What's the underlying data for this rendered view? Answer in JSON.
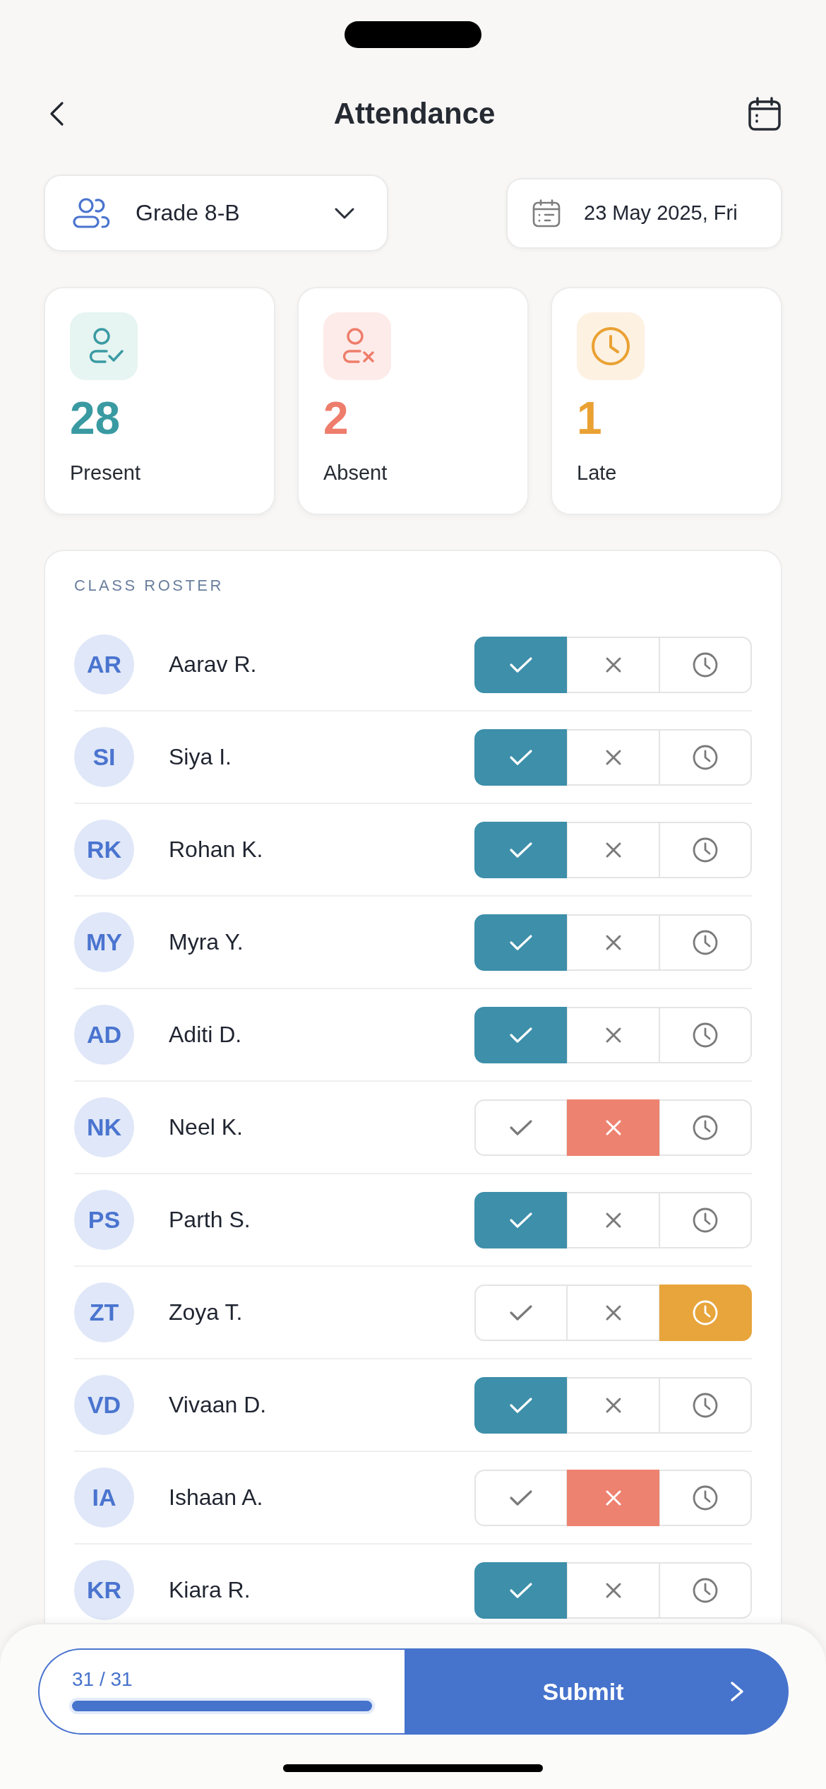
{
  "header": {
    "title": "Attendance"
  },
  "class_picker": {
    "value": "Grade 8-B"
  },
  "date_picker": {
    "value": "23 May 2025, Fri"
  },
  "stats": [
    {
      "kind": "present",
      "count": "28",
      "label": "Present"
    },
    {
      "kind": "absent",
      "count": "2",
      "label": "Absent"
    },
    {
      "kind": "late",
      "count": "1",
      "label": "Late"
    }
  ],
  "roster": {
    "heading": "CLASS ROSTER",
    "students": [
      {
        "initials": "AR",
        "name": "Aarav R.",
        "marks": [
          {
            "kind": "present",
            "selected": true
          },
          {
            "kind": "absent",
            "selected": false
          },
          {
            "kind": "late",
            "selected": false
          }
        ]
      },
      {
        "initials": "SI",
        "name": "Siya I.",
        "marks": [
          {
            "kind": "present",
            "selected": true
          },
          {
            "kind": "absent",
            "selected": false
          },
          {
            "kind": "late",
            "selected": false
          }
        ]
      },
      {
        "initials": "RK",
        "name": "Rohan K.",
        "marks": [
          {
            "kind": "present",
            "selected": true
          },
          {
            "kind": "absent",
            "selected": false
          },
          {
            "kind": "late",
            "selected": false
          }
        ]
      },
      {
        "initials": "MY",
        "name": "Myra Y.",
        "marks": [
          {
            "kind": "present",
            "selected": true
          },
          {
            "kind": "absent",
            "selected": false
          },
          {
            "kind": "late",
            "selected": false
          }
        ]
      },
      {
        "initials": "AD",
        "name": "Aditi D.",
        "marks": [
          {
            "kind": "present",
            "selected": true
          },
          {
            "kind": "absent",
            "selected": false
          },
          {
            "kind": "late",
            "selected": false
          }
        ]
      },
      {
        "initials": "NK",
        "name": "Neel K.",
        "marks": [
          {
            "kind": "present",
            "selected": false
          },
          {
            "kind": "absent",
            "selected": true
          },
          {
            "kind": "late",
            "selected": false
          }
        ]
      },
      {
        "initials": "PS",
        "name": "Parth S.",
        "marks": [
          {
            "kind": "present",
            "selected": true
          },
          {
            "kind": "absent",
            "selected": false
          },
          {
            "kind": "late",
            "selected": false
          }
        ]
      },
      {
        "initials": "ZT",
        "name": "Zoya T.",
        "marks": [
          {
            "kind": "present",
            "selected": false
          },
          {
            "kind": "absent",
            "selected": false
          },
          {
            "kind": "late",
            "selected": true
          }
        ]
      },
      {
        "initials": "VD",
        "name": "Vivaan D.",
        "marks": [
          {
            "kind": "present",
            "selected": true
          },
          {
            "kind": "absent",
            "selected": false
          },
          {
            "kind": "late",
            "selected": false
          }
        ]
      },
      {
        "initials": "IA",
        "name": "Ishaan A.",
        "marks": [
          {
            "kind": "present",
            "selected": false
          },
          {
            "kind": "absent",
            "selected": true
          },
          {
            "kind": "late",
            "selected": false
          }
        ]
      },
      {
        "initials": "KR",
        "name": "Kiara R.",
        "marks": [
          {
            "kind": "present",
            "selected": true
          },
          {
            "kind": "absent",
            "selected": false
          },
          {
            "kind": "late",
            "selected": false
          }
        ]
      }
    ]
  },
  "footer": {
    "progress": "31 / 31",
    "level": 1,
    "submit": "Submit"
  }
}
